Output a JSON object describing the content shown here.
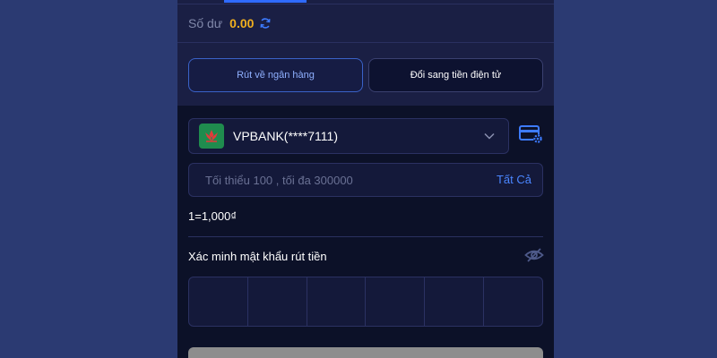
{
  "balance": {
    "label": "Số dư",
    "value": "0.00"
  },
  "methods": [
    {
      "label": "Rút về ngân hàng",
      "active": true
    },
    {
      "label": "Đổi sang tiền điện tử",
      "active": false
    }
  ],
  "bank": {
    "name": "VPBANK(****7111)"
  },
  "amount": {
    "placeholder": "Tối thiểu 100 , tối đa 300000",
    "all_label": "Tất Cả"
  },
  "rate": "1=1,000₫",
  "password": {
    "label": "Xác minh mật khẩu rút tiền",
    "cells": 6
  },
  "colors": {
    "accent": "#2f6bff",
    "balance": "#f2b01e",
    "background": "#2b3a72"
  }
}
